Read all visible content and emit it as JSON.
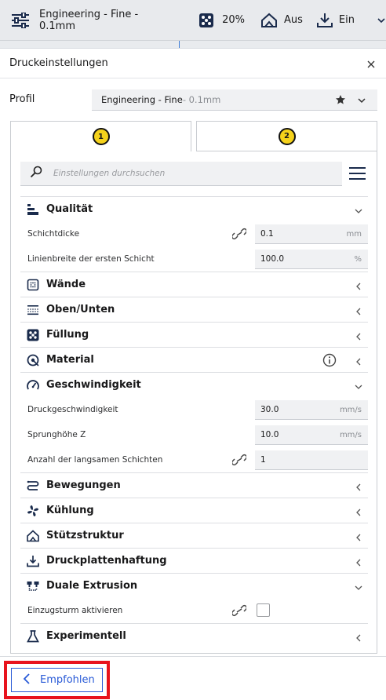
{
  "toolbar": {
    "profile_label": "Engineering - Fine - 0.1mm",
    "infill_value": "20%",
    "support_value": "Aus",
    "adhesion_value": "Ein"
  },
  "panel": {
    "title": "Druckeinstellungen",
    "profile": {
      "label": "Profil",
      "name": "Engineering - Fine",
      "suffix": " - 0.1mm"
    },
    "tabs": [
      {
        "badge": "1",
        "active": true
      },
      {
        "badge": "2",
        "active": false
      }
    ],
    "search_placeholder": "Einstellungen durchsuchen",
    "categories": {
      "quality": "Qualität",
      "walls": "Wände",
      "topbottom": "Oben/Unten",
      "infill": "Füllung",
      "material": "Material",
      "speed": "Geschwindigkeit",
      "travel": "Bewegungen",
      "cooling": "Kühlung",
      "support": "Stützstruktur",
      "adhesion": "Druckplattenhaftung",
      "dual": "Duale Extrusion",
      "experimental": "Experimentell"
    },
    "settings": {
      "layer_height": {
        "label": "Schichtdicke",
        "value": "0.1",
        "unit": "mm"
      },
      "initial_line_width": {
        "label": "Linienbreite der ersten Schicht",
        "value": "100.0",
        "unit": "%"
      },
      "print_speed": {
        "label": "Druckgeschwindigkeit",
        "value": "30.0",
        "unit": "mm/s"
      },
      "z_hop": {
        "label": "Sprunghöhe Z",
        "value": "10.0",
        "unit": "mm/s"
      },
      "slow_layers": {
        "label": "Anzahl der langsamen Schichten",
        "value": "1"
      },
      "prime_tower": {
        "label": "Einzugsturm aktivieren",
        "checked": false
      }
    }
  },
  "footer": {
    "recommended_label": "Empfohlen"
  },
  "colors": {
    "accent": "#2a5bd7",
    "badge": "#f5d21b",
    "highlight": "#e8131d"
  }
}
